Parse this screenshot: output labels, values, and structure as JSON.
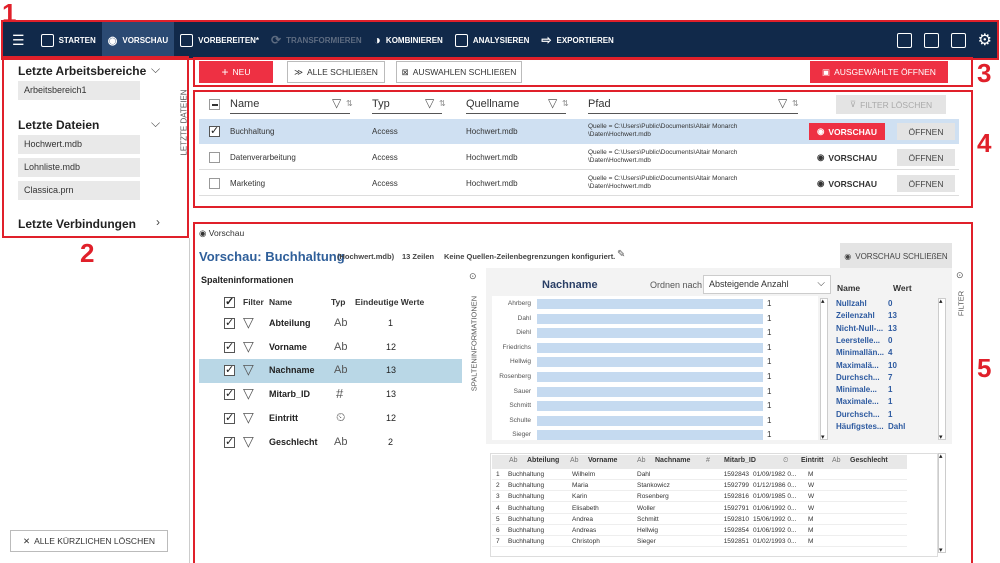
{
  "callouts": [
    "1",
    "2",
    "3",
    "4",
    "5"
  ],
  "toolbar": {
    "items": [
      {
        "label": "STARTEN",
        "icon": "cube-icon",
        "state": "normal"
      },
      {
        "label": "VORSCHAU",
        "icon": "eye-icon",
        "state": "active"
      },
      {
        "label": "VORBEREITEN*",
        "icon": "columns-icon",
        "state": "normal"
      },
      {
        "label": "TRANSFORMIEREN",
        "icon": "sync-icon",
        "state": "disabled"
      },
      {
        "label": "KOMBINIEREN",
        "icon": "combine-icon",
        "state": "normal"
      },
      {
        "label": "ANALYSIEREN",
        "icon": "report-icon",
        "state": "normal"
      },
      {
        "label": "EXPORTIEREN",
        "icon": "export-icon",
        "state": "normal"
      }
    ],
    "right_icons": [
      "info-icon",
      "window-icon",
      "user-search-icon",
      "settings-icon"
    ]
  },
  "left_panel": {
    "workspaces_title": "Letzte Arbeitsbereiche",
    "workspaces": [
      "Arbeitsbereich1"
    ],
    "files_title": "Letzte Dateien",
    "files": [
      "Hochwert.mdb",
      "Lohnliste.mdb",
      "Classica.prn"
    ],
    "connections_title": "Letzte Verbindungen",
    "vertical_tab": "LETZTE DATEIEN",
    "clear_button": "ALLE KÜRZLICHEN LÖSCHEN"
  },
  "actions": {
    "new": "NEU",
    "close_all": "ALLE SCHLIEßEN",
    "close_selection": "AUSWAHLEN SCHLIEßEN",
    "open_selected": "AUSGEWÄHLTE ÖFFNEN"
  },
  "sources": {
    "headers": [
      "Name",
      "Typ",
      "Quellname",
      "Pfad"
    ],
    "clear_filter": "FILTER LÖSCHEN",
    "rows": [
      {
        "name": "Buchhaltung",
        "type": "Access",
        "source": "Hochwert.mdb",
        "path1": "Quelle = C:\\Users\\Public\\Documents\\Altair Monarch",
        "path2": "\\Daten\\Hochwert.mdb",
        "preview": "VORSCHAU",
        "open": "ÖFFNEN",
        "checked": true
      },
      {
        "name": "Datenverarbeitung",
        "type": "Access",
        "source": "Hochwert.mdb",
        "path1": "Quelle = C:\\Users\\Public\\Documents\\Altair Monarch",
        "path2": "\\Daten\\Hochwert.mdb",
        "preview": "VORSCHAU",
        "open": "ÖFFNEN",
        "checked": false
      },
      {
        "name": "Marketing",
        "type": "Access",
        "source": "Hochwert.mdb",
        "path1": "Quelle = C:\\Users\\Public\\Documents\\Altair Monarch",
        "path2": "\\Daten\\Hochwert.mdb",
        "preview": "VORSCHAU",
        "open": "ÖFFNEN",
        "checked": false
      }
    ]
  },
  "preview": {
    "toggle": "Vorschau",
    "title": "Vorschau: Buchhaltung",
    "file": "(Hochwert.mdb)",
    "rows_info": "13 Zeilen",
    "limit_info": "Keine Quellen-Zeilenbegrenzungen konfiguriert.",
    "close": "VORSCHAU SCHLIEßEN",
    "col_info_title": "Spalteninformationen",
    "col_info_vertical": "SPALTENINFORMATIONEN",
    "filter_vertical": "FILTER",
    "col_headers": [
      "Filter",
      "Name",
      "Typ",
      "Eindeutige Werte"
    ],
    "columns": [
      {
        "name": "Abteilung",
        "type": "Ab",
        "unique": "1"
      },
      {
        "name": "Vorname",
        "type": "Ab",
        "unique": "12"
      },
      {
        "name": "Nachname",
        "type": "Ab",
        "unique": "13"
      },
      {
        "name": "Mitarb_ID",
        "type": "#",
        "unique": "13"
      },
      {
        "name": "Eintritt",
        "type": "⏲",
        "unique": "12"
      },
      {
        "name": "Geschlecht",
        "type": "Ab",
        "unique": "2"
      }
    ],
    "field_title": "Nachname",
    "sort_label": "Ordnen nach",
    "sort_value": "Absteigende Anzahl",
    "bars": [
      {
        "label": "Ahrberg",
        "value": "1"
      },
      {
        "label": "Dahl",
        "value": "1"
      },
      {
        "label": "Diehl",
        "value": "1"
      },
      {
        "label": "Friedrichs",
        "value": "1"
      },
      {
        "label": "Hellwig",
        "value": "1"
      },
      {
        "label": "Rosenberg",
        "value": "1"
      },
      {
        "label": "Sauer",
        "value": "1"
      },
      {
        "label": "Schmitt",
        "value": "1"
      },
      {
        "label": "Schulte",
        "value": "1"
      },
      {
        "label": "Sieger",
        "value": "1"
      }
    ],
    "stats_headers": [
      "Name",
      "Wert"
    ],
    "stats": [
      {
        "name": "Nullzahl",
        "value": "0"
      },
      {
        "name": "Zeilenzahl",
        "value": "13"
      },
      {
        "name": "Nicht-Null-...",
        "value": "13"
      },
      {
        "name": "Leerstelle...",
        "value": "0"
      },
      {
        "name": "Minimallän...",
        "value": "4"
      },
      {
        "name": "Maximalä...",
        "value": "10"
      },
      {
        "name": "Durchsch...",
        "value": "7"
      },
      {
        "name": "Minimale...",
        "value": "1"
      },
      {
        "name": "Maximale...",
        "value": "1"
      },
      {
        "name": "Durchsch...",
        "value": "1"
      },
      {
        "name": "Häufigstes...",
        "value": "Dahl"
      }
    ],
    "grid_headers": [
      {
        "type": "Ab",
        "name": "Abteilung"
      },
      {
        "type": "Ab",
        "name": "Vorname"
      },
      {
        "type": "Ab",
        "name": "Nachname"
      },
      {
        "type": "#",
        "name": "Mitarb_ID"
      },
      {
        "type": "⏲",
        "name": "Eintritt"
      },
      {
        "type": "Ab",
        "name": "Geschlecht"
      }
    ],
    "grid_rows": [
      [
        "1",
        "Buchhaltung",
        "Wilhelm",
        "Dahl",
        "1592843",
        "01/09/1982 0...",
        "M"
      ],
      [
        "2",
        "Buchhaltung",
        "Maria",
        "Stankowicz",
        "1592799",
        "01/12/1986 0...",
        "W"
      ],
      [
        "3",
        "Buchhaltung",
        "Karin",
        "Rosenberg",
        "1592816",
        "01/09/1985 0...",
        "W"
      ],
      [
        "4",
        "Buchhaltung",
        "Elisabeth",
        "Woller",
        "1592791",
        "01/06/1992 0...",
        "W"
      ],
      [
        "5",
        "Buchhaltung",
        "Andrea",
        "Schmitt",
        "1592810",
        "15/06/1992 0...",
        "M"
      ],
      [
        "6",
        "Buchhaltung",
        "Andreas",
        "Hellwig",
        "1592854",
        "01/06/1992 0...",
        "M"
      ],
      [
        "7",
        "Buchhaltung",
        "Christoph",
        "Sieger",
        "1592851",
        "01/02/1993 0...",
        "M"
      ]
    ]
  }
}
